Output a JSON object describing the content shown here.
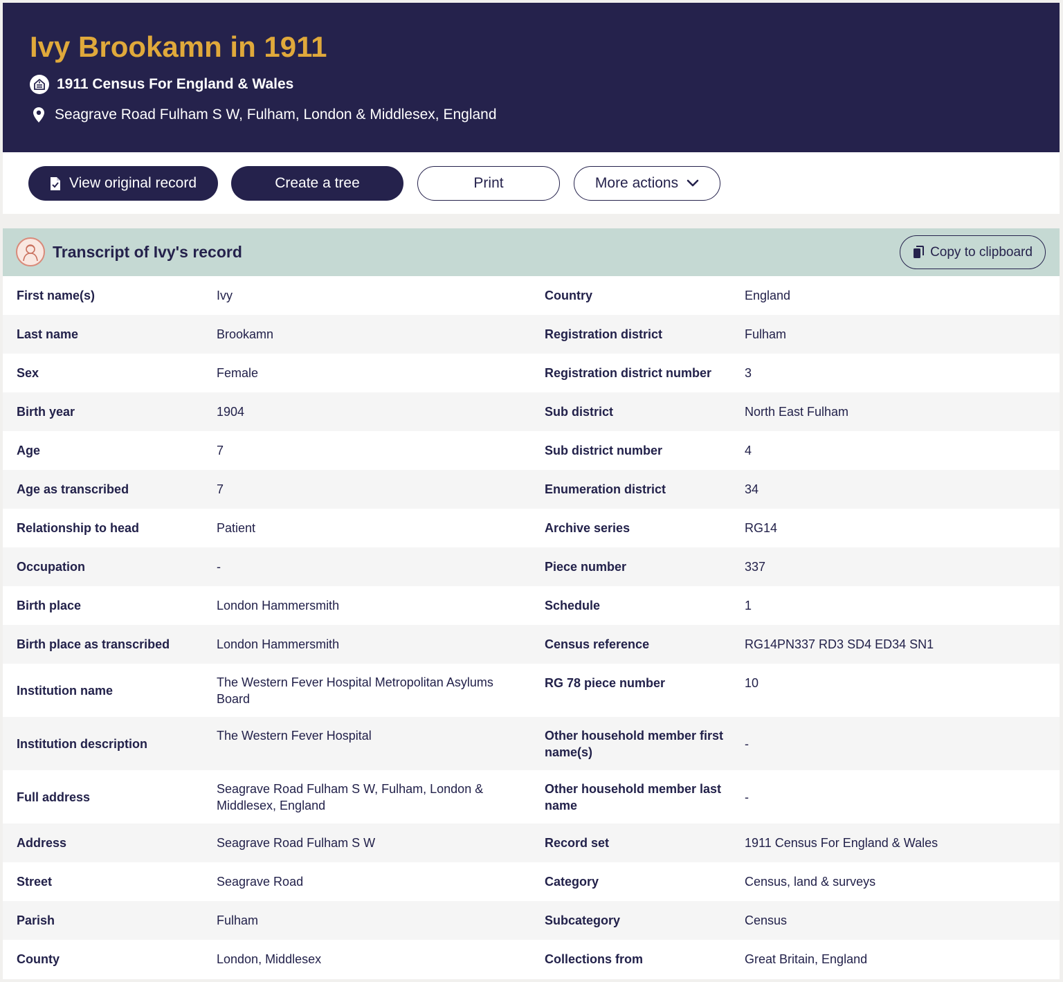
{
  "header": {
    "title": "Ivy Brookamn in 1911",
    "record_set": "1911 Census For England & Wales",
    "location": "Seagrave Road Fulham S W, Fulham, London & Middlesex, England"
  },
  "actions": {
    "view_original": "View original record",
    "create_tree": "Create a tree",
    "print": "Print",
    "more_actions": "More actions"
  },
  "transcript": {
    "title": "Transcript of Ivy's record",
    "copy_label": "Copy to clipboard",
    "rows": [
      {
        "l1": "First name(s)",
        "v1": "Ivy",
        "l2": "Country",
        "v2": "England"
      },
      {
        "l1": "Last name",
        "v1": "Brookamn",
        "l2": "Registration district",
        "v2": "Fulham"
      },
      {
        "l1": "Sex",
        "v1": "Female",
        "l2": "Registration district number",
        "v2": "3"
      },
      {
        "l1": "Birth year",
        "v1": "1904",
        "l2": "Sub district",
        "v2": "North East Fulham"
      },
      {
        "l1": "Age",
        "v1": "7",
        "l2": "Sub district number",
        "v2": "4"
      },
      {
        "l1": "Age as transcribed",
        "v1": "7",
        "l2": "Enumeration district",
        "v2": "34"
      },
      {
        "l1": "Relationship to head",
        "v1": "Patient",
        "l2": "Archive series",
        "v2": "RG14"
      },
      {
        "l1": "Occupation",
        "v1": "-",
        "l2": "Piece number",
        "v2": "337"
      },
      {
        "l1": "Birth place",
        "v1": "London Hammersmith",
        "l2": "Schedule",
        "v2": "1"
      },
      {
        "l1": "Birth place as transcribed",
        "v1": "London Hammersmith",
        "l2": "Census reference",
        "v2": "RG14PN337 RD3 SD4 ED34 SN1"
      },
      {
        "l1": "Institution name",
        "v1": "The Western Fever Hospital Metropolitan Asylums Board",
        "l2": "RG 78 piece number",
        "v2": "10"
      },
      {
        "l1": "Institution description",
        "v1": "The Western Fever Hospital",
        "l2": "Other household member first name(s)",
        "v2": "-"
      },
      {
        "l1": "Full address",
        "v1": "Seagrave Road Fulham S W, Fulham, London & Middlesex, England",
        "l2": "Other household member last name",
        "v2": "-"
      },
      {
        "l1": "Address",
        "v1": "Seagrave Road Fulham S W",
        "l2": "Record set",
        "v2": "1911 Census For England & Wales"
      },
      {
        "l1": "Street",
        "v1": "Seagrave Road",
        "l2": "Category",
        "v2": "Census, land & surveys"
      },
      {
        "l1": "Parish",
        "v1": "Fulham",
        "l2": "Subcategory",
        "v2": "Census"
      },
      {
        "l1": "County",
        "v1": "London, Middlesex",
        "l2": "Collections from",
        "v2": "Great Britain, England"
      }
    ]
  }
}
